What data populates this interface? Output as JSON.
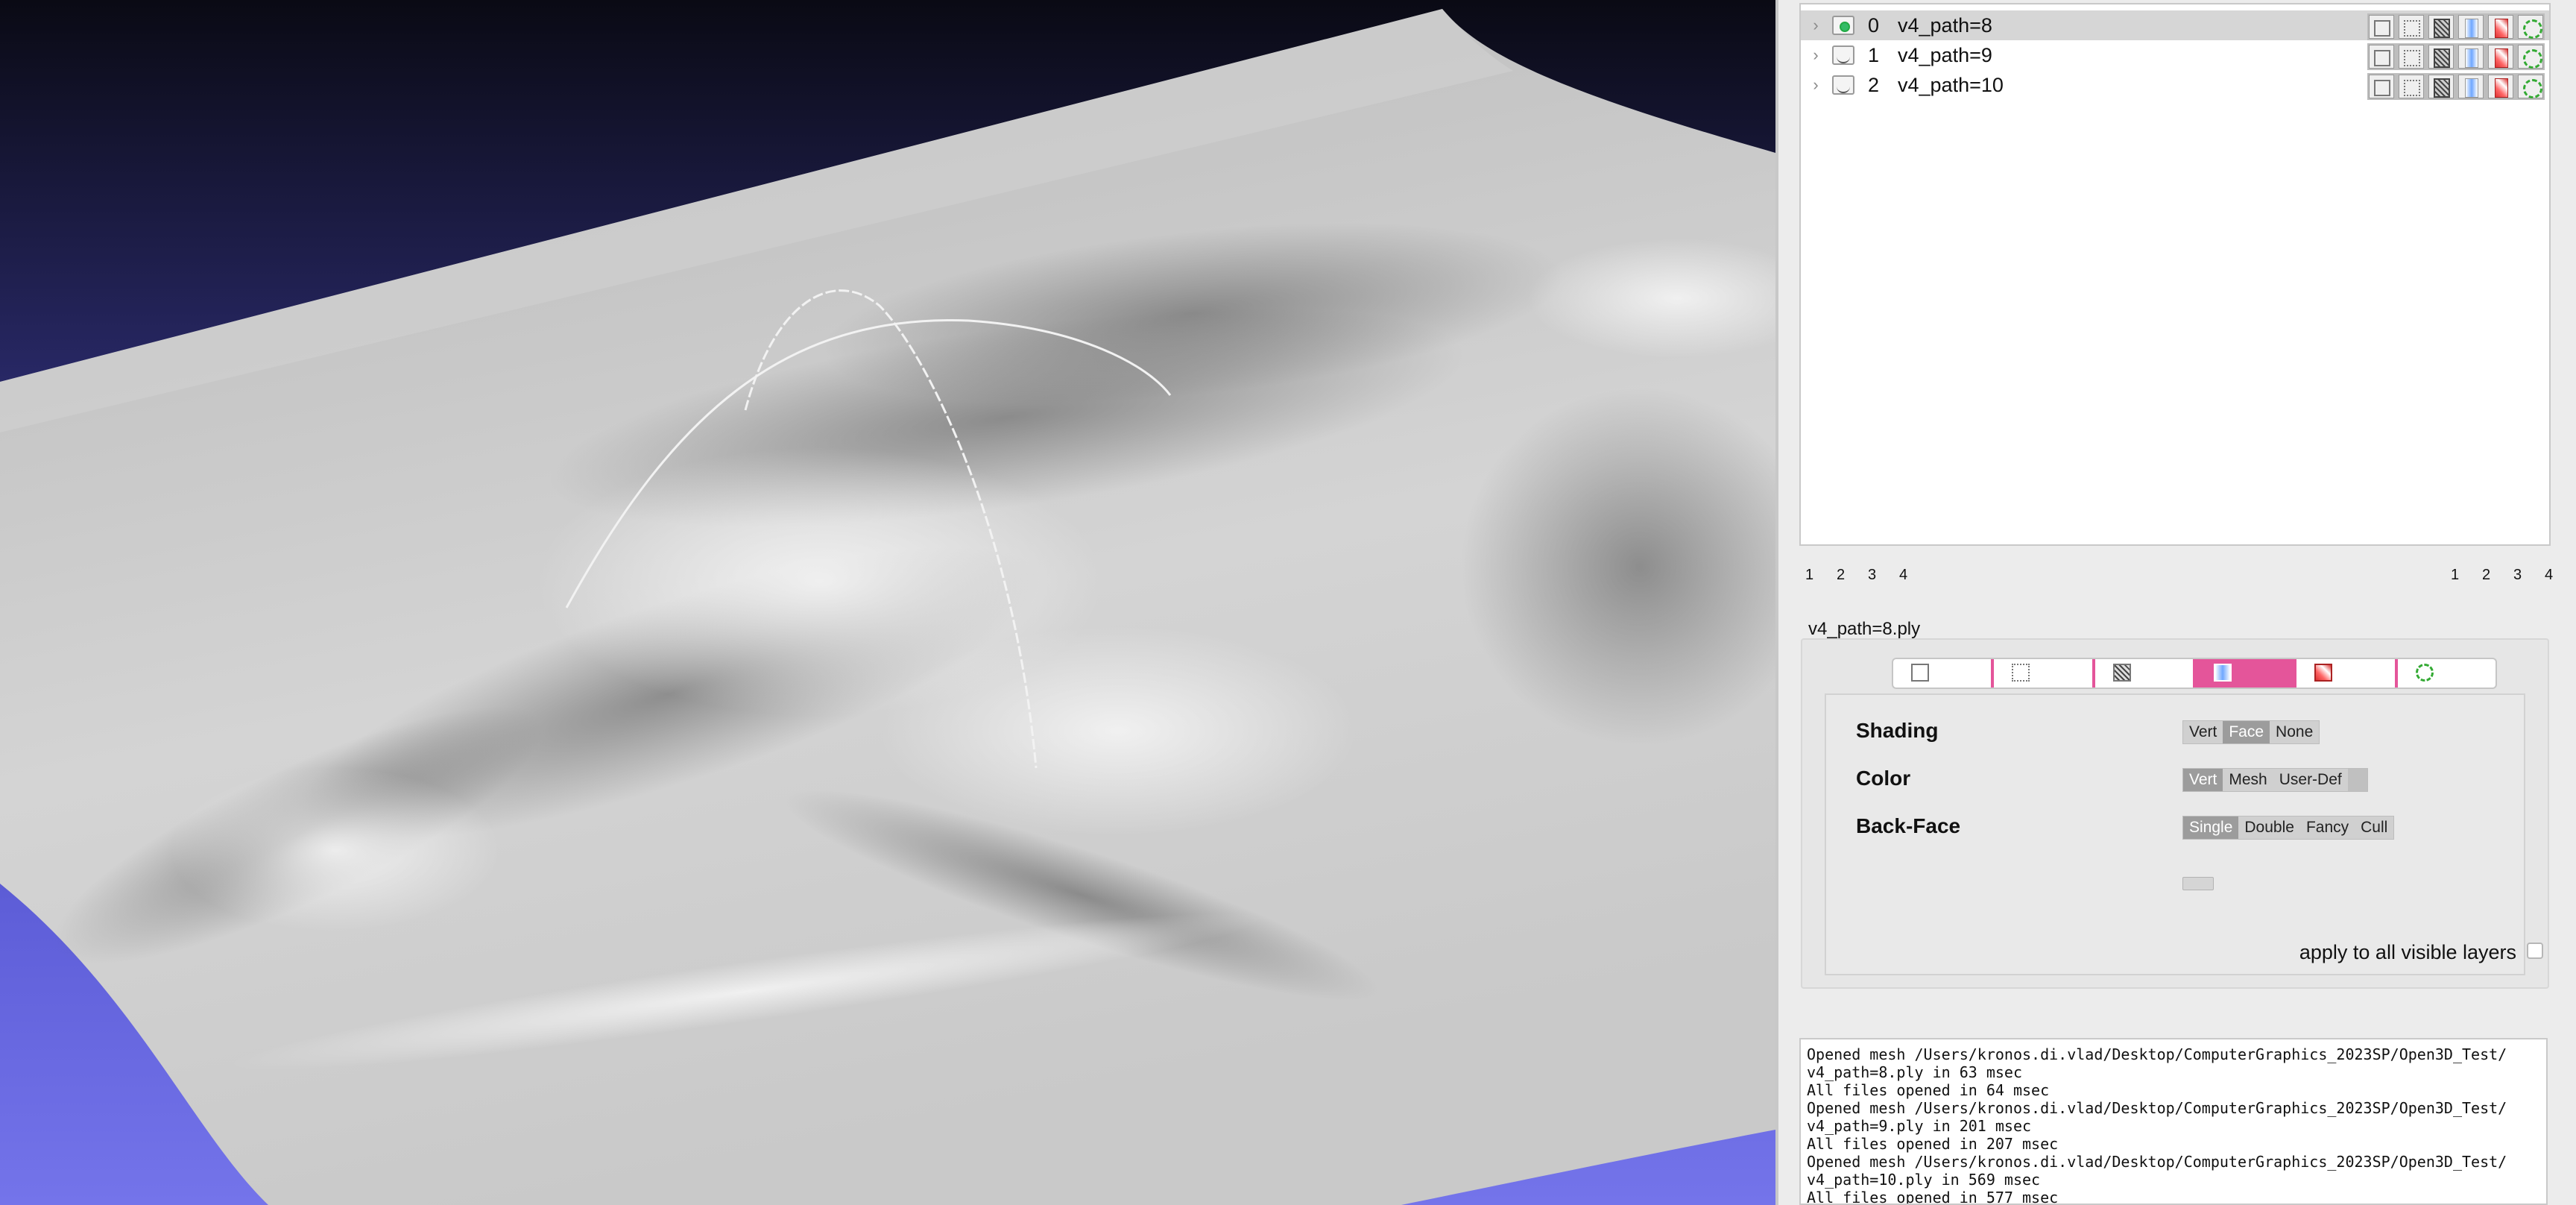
{
  "layers": [
    {
      "index": "0",
      "name": "v4_path=8",
      "selected": true,
      "icon": "mesh-visible-icon"
    },
    {
      "index": "1",
      "name": "v4_path=9",
      "selected": false,
      "icon": "curve-icon"
    },
    {
      "index": "2",
      "name": "v4_path=10",
      "selected": false,
      "icon": "curve-icon"
    }
  ],
  "pager_left": [
    "1",
    "2",
    "3",
    "4"
  ],
  "pager_right": [
    "1",
    "2",
    "3",
    "4"
  ],
  "decorator": {
    "filename": "v4_path=8.ply",
    "active_tab_color": "#e4559a",
    "shading": {
      "label": "Shading",
      "options": [
        "Vert",
        "Face",
        "None"
      ],
      "selected": "Face"
    },
    "color": {
      "label": "Color",
      "options": [
        "Vert",
        "Mesh",
        "User-Def"
      ],
      "selected": "Vert"
    },
    "backface": {
      "label": "Back-Face",
      "options": [
        "Single",
        "Double",
        "Fancy",
        "Cull"
      ],
      "selected": "Single"
    },
    "apply_label": "apply to all visible layers"
  },
  "log": [
    "Opened mesh /Users/kronos.di.vlad/Desktop/ComputerGraphics_2023SP/Open3D_Test/",
    "v4_path=8.ply in 63 msec",
    "All files opened in 64 msec",
    "Opened mesh /Users/kronos.di.vlad/Desktop/ComputerGraphics_2023SP/Open3D_Test/",
    "v4_path=9.ply in 201 msec",
    "All files opened in 207 msec",
    "Opened mesh /Users/kronos.di.vlad/Desktop/ComputerGraphics_2023SP/Open3D_Test/",
    "v4_path=10.ply in 569 msec",
    "All files opened in 577 msec"
  ]
}
